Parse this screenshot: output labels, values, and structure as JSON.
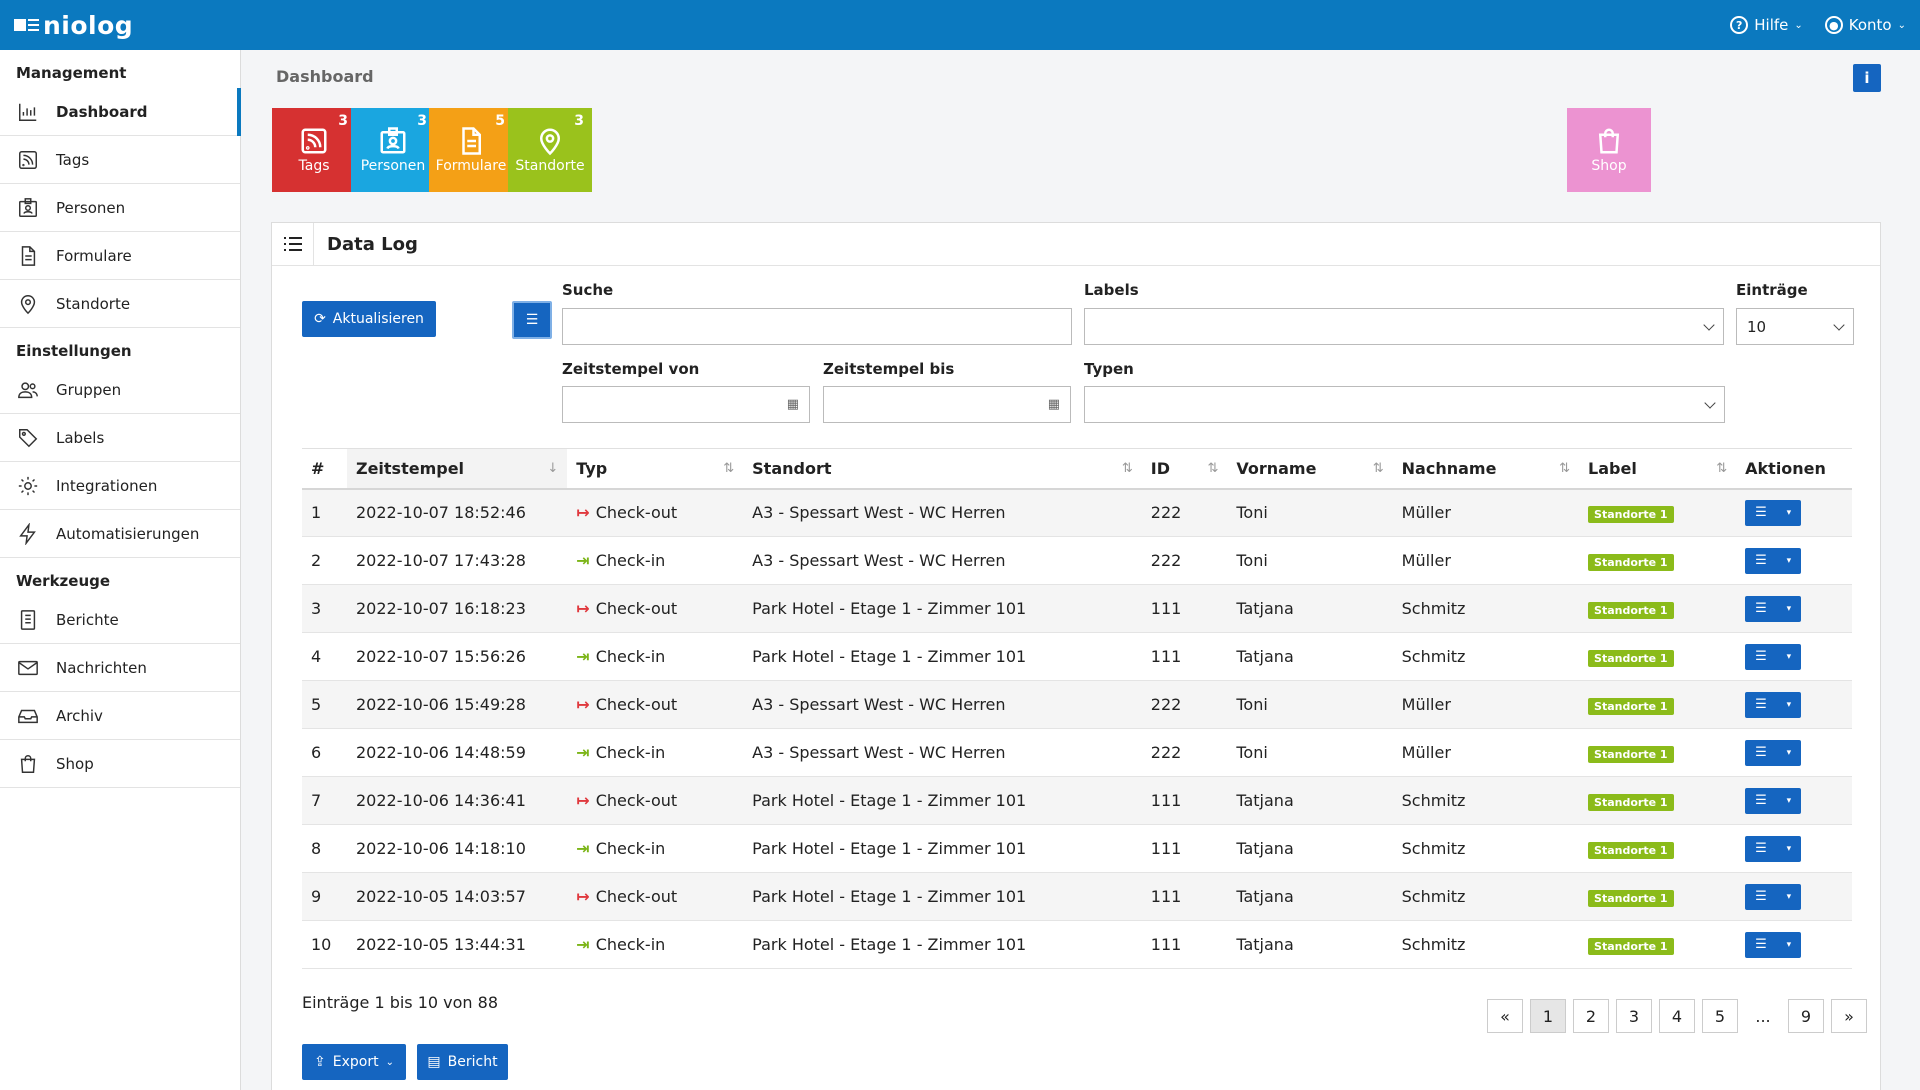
{
  "app": {
    "logo": "niolog",
    "help_label": "Hilfe",
    "account_label": "Konto"
  },
  "sidebar": {
    "sections": [
      {
        "title": "Management",
        "items": [
          {
            "label": "Dashboard",
            "icon": "chart-icon",
            "active": true
          },
          {
            "label": "Tags",
            "icon": "rss-icon"
          },
          {
            "label": "Personen",
            "icon": "id-card-icon"
          },
          {
            "label": "Formulare",
            "icon": "document-icon"
          },
          {
            "label": "Standorte",
            "icon": "map-pin-icon"
          }
        ]
      },
      {
        "title": "Einstellungen",
        "items": [
          {
            "label": "Gruppen",
            "icon": "users-icon"
          },
          {
            "label": "Labels",
            "icon": "tag-icon"
          },
          {
            "label": "Integrationen",
            "icon": "gear-icon"
          },
          {
            "label": "Automatisierungen",
            "icon": "lightning-icon"
          }
        ]
      },
      {
        "title": "Werkzeuge",
        "items": [
          {
            "label": "Berichte",
            "icon": "report-icon"
          },
          {
            "label": "Nachrichten",
            "icon": "mail-icon"
          },
          {
            "label": "Archiv",
            "icon": "inbox-icon"
          },
          {
            "label": "Shop",
            "icon": "bag-icon"
          }
        ]
      }
    ]
  },
  "page": {
    "title": "Dashboard",
    "info_label": "i"
  },
  "tiles": [
    {
      "label": "Tags",
      "count": "3",
      "color": "#d63131",
      "icon": "rss-icon"
    },
    {
      "label": "Personen",
      "count": "3",
      "color": "#1aa6e0",
      "icon": "id-card-icon"
    },
    {
      "label": "Formulare",
      "count": "5",
      "color": "#f4a016",
      "icon": "document-icon"
    },
    {
      "label": "Standorte",
      "count": "3",
      "color": "#9ac21c",
      "icon": "map-pin-icon"
    },
    {
      "label": "Shop",
      "count": "",
      "color": "#ec93d1",
      "icon": "bag-icon"
    }
  ],
  "datalog": {
    "title": "Data Log",
    "refresh_label": "Aktualisieren",
    "search_label": "Suche",
    "search_value": "",
    "labels_label": "Labels",
    "entries_label": "Einträge",
    "entries_value": "10",
    "from_label": "Zeitstempel von",
    "to_label": "Zeitstempel bis",
    "types_label": "Typen",
    "columns": [
      "#",
      "Zeitstempel",
      "Typ",
      "Standort",
      "ID",
      "Vorname",
      "Nachname",
      "Label",
      "Aktionen"
    ],
    "rows": [
      {
        "n": "1",
        "ts": "2022-10-07 18:52:46",
        "typ": "Check-out",
        "loc": "A3 - Spessart West - WC Herren",
        "id": "222",
        "first": "Toni",
        "last": "Müller",
        "label": "Standorte 1"
      },
      {
        "n": "2",
        "ts": "2022-10-07 17:43:28",
        "typ": "Check-in",
        "loc": "A3 - Spessart West - WC Herren",
        "id": "222",
        "first": "Toni",
        "last": "Müller",
        "label": "Standorte 1"
      },
      {
        "n": "3",
        "ts": "2022-10-07 16:18:23",
        "typ": "Check-out",
        "loc": "Park Hotel - Etage 1 - Zimmer 101",
        "id": "111",
        "first": "Tatjana",
        "last": "Schmitz",
        "label": "Standorte 1"
      },
      {
        "n": "4",
        "ts": "2022-10-07 15:56:26",
        "typ": "Check-in",
        "loc": "Park Hotel - Etage 1 - Zimmer 101",
        "id": "111",
        "first": "Tatjana",
        "last": "Schmitz",
        "label": "Standorte 1"
      },
      {
        "n": "5",
        "ts": "2022-10-06 15:49:28",
        "typ": "Check-out",
        "loc": "A3 - Spessart West - WC Herren",
        "id": "222",
        "first": "Toni",
        "last": "Müller",
        "label": "Standorte 1"
      },
      {
        "n": "6",
        "ts": "2022-10-06 14:48:59",
        "typ": "Check-in",
        "loc": "A3 - Spessart West - WC Herren",
        "id": "222",
        "first": "Toni",
        "last": "Müller",
        "label": "Standorte 1"
      },
      {
        "n": "7",
        "ts": "2022-10-06 14:36:41",
        "typ": "Check-out",
        "loc": "Park Hotel - Etage 1 - Zimmer 101",
        "id": "111",
        "first": "Tatjana",
        "last": "Schmitz",
        "label": "Standorte 1"
      },
      {
        "n": "8",
        "ts": "2022-10-06 14:18:10",
        "typ": "Check-in",
        "loc": "Park Hotel - Etage 1 - Zimmer 101",
        "id": "111",
        "first": "Tatjana",
        "last": "Schmitz",
        "label": "Standorte 1"
      },
      {
        "n": "9",
        "ts": "2022-10-05 14:03:57",
        "typ": "Check-out",
        "loc": "Park Hotel - Etage 1 - Zimmer 101",
        "id": "111",
        "first": "Tatjana",
        "last": "Schmitz",
        "label": "Standorte 1"
      },
      {
        "n": "10",
        "ts": "2022-10-05 13:44:31",
        "typ": "Check-in",
        "loc": "Park Hotel - Etage 1 - Zimmer 101",
        "id": "111",
        "first": "Tatjana",
        "last": "Schmitz",
        "label": "Standorte 1"
      }
    ],
    "summary": "Einträge 1 bis 10 von 88",
    "pages": [
      "«",
      "1",
      "2",
      "3",
      "4",
      "5",
      "...",
      "9",
      "»"
    ],
    "active_page": "1",
    "export_label": "Export",
    "report_label": "Bericht",
    "colors": {
      "checkout": "#e0393e",
      "checkin": "#7cb518",
      "primary": "#1565c0"
    }
  }
}
